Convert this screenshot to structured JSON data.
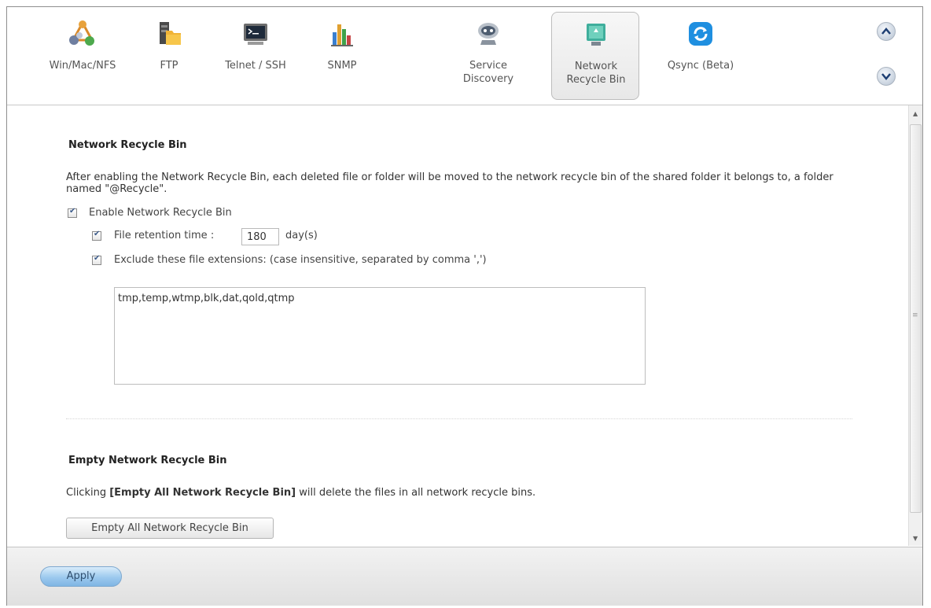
{
  "toolbar": {
    "items": [
      {
        "label": "Win/Mac/NFS",
        "icon": "network-share-icon"
      },
      {
        "label": "FTP",
        "icon": "ftp-folder-icon"
      },
      {
        "label": "Telnet / SSH",
        "icon": "terminal-icon"
      },
      {
        "label": "SNMP",
        "icon": "bar-chart-icon"
      },
      {
        "label": "Service Discovery",
        "label_line1": "Service",
        "label_line2": "Discovery",
        "icon": "service-discovery-icon"
      },
      {
        "label": "Network Recycle Bin",
        "label_line1": "Network",
        "label_line2": "Recycle Bin",
        "icon": "recycle-bin-icon",
        "active": true
      },
      {
        "label": "Qsync (Beta)",
        "icon": "sync-icon"
      }
    ]
  },
  "recycle": {
    "title": "Network Recycle Bin",
    "description": "After enabling the Network Recycle Bin, each deleted file or folder will be moved to the network recycle bin of the shared folder it belongs to, a folder named \"@Recycle\".",
    "enable_label": "Enable Network Recycle Bin",
    "enable_checked": true,
    "retention_label": "File retention time :",
    "retention_value": "180",
    "retention_unit": "day(s)",
    "retention_checked": true,
    "exclude_label": "Exclude these file extensions: (case insensitive, separated by comma ',')",
    "exclude_checked": true,
    "extensions": "tmp,temp,wtmp,blk,dat,qold,qtmp"
  },
  "empty": {
    "title": "Empty Network Recycle Bin",
    "desc_prefix": "Clicking ",
    "desc_bold": "[Empty All Network Recycle Bin]",
    "desc_suffix": " will delete the files in all network recycle bins.",
    "button_label": "Empty All Network Recycle Bin"
  },
  "footer": {
    "apply_label": "Apply"
  },
  "colors": {
    "accent": "#7fb5e4",
    "active_tab_bg": "#e8e8e8"
  }
}
